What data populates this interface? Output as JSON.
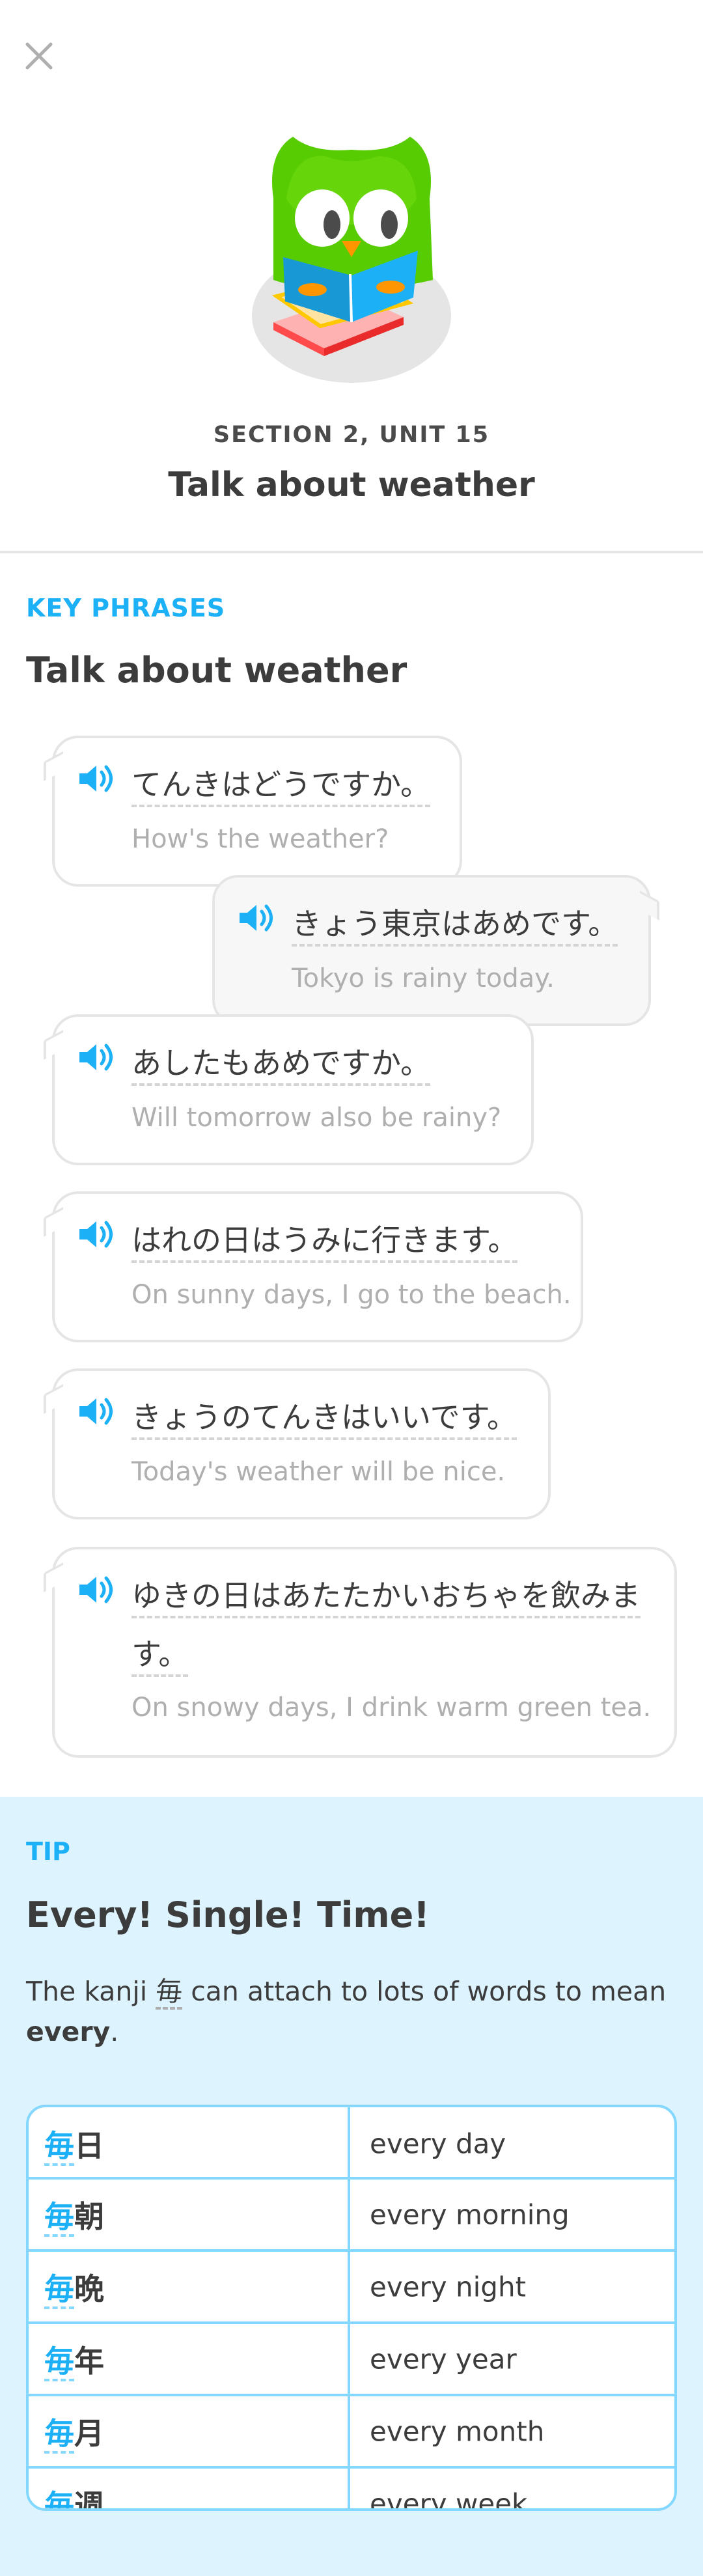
{
  "header": {
    "close_icon": "close-icon",
    "section_label": "SECTION 2, UNIT 15",
    "unit_title": "Talk about weather"
  },
  "key_phrases": {
    "label": "KEY PHRASES",
    "title": "Talk about weather",
    "phrases": [
      {
        "jp": "てんきはどうですか。",
        "en": "How's the weather?",
        "side": "left"
      },
      {
        "jp": "きょう東京はあめです。",
        "en": "Tokyo is rainy today.",
        "side": "right"
      },
      {
        "jp": "あしたもあめですか。",
        "en": "Will tomorrow also be rainy?",
        "side": "left"
      },
      {
        "jp": "はれの日はうみに行きます。",
        "en": "On sunny days, I go to the beach.",
        "side": "left"
      },
      {
        "jp": "きょうのてんきはいいです。",
        "en": "Today's weather will be nice.",
        "side": "left"
      },
      {
        "jp_line1": "ゆきの日はあたたかいおちゃを飲みま",
        "jp_line2": "す。",
        "en": "On snowy days, I drink warm green tea.",
        "side": "left"
      }
    ]
  },
  "tip": {
    "label": "TIP",
    "title": "Every! Single! Time!",
    "body_part1": "The kanji ",
    "body_kanji": "毎",
    "body_part2": " can attach to lots of words to mean ",
    "body_bold": "every",
    "body_end": ".",
    "table": [
      {
        "prefix": "毎",
        "suffix": "日",
        "meaning": "every day"
      },
      {
        "prefix": "毎",
        "suffix": "朝",
        "meaning": "every morning"
      },
      {
        "prefix": "毎",
        "suffix": "晩",
        "meaning": "every night"
      },
      {
        "prefix": "毎",
        "suffix": "年",
        "meaning": "every year"
      },
      {
        "prefix": "毎",
        "suffix": "月",
        "meaning": "every month"
      },
      {
        "prefix": "毎",
        "suffix": "週",
        "meaning": "every week"
      }
    ]
  },
  "colors": {
    "accent_blue": "#1cb0f6",
    "tip_background": "#ddf4ff",
    "table_border": "#84d8ff",
    "mascot_green": "#58cc02",
    "text_dark": "#3c3c3c",
    "text_muted": "#afafaf"
  }
}
